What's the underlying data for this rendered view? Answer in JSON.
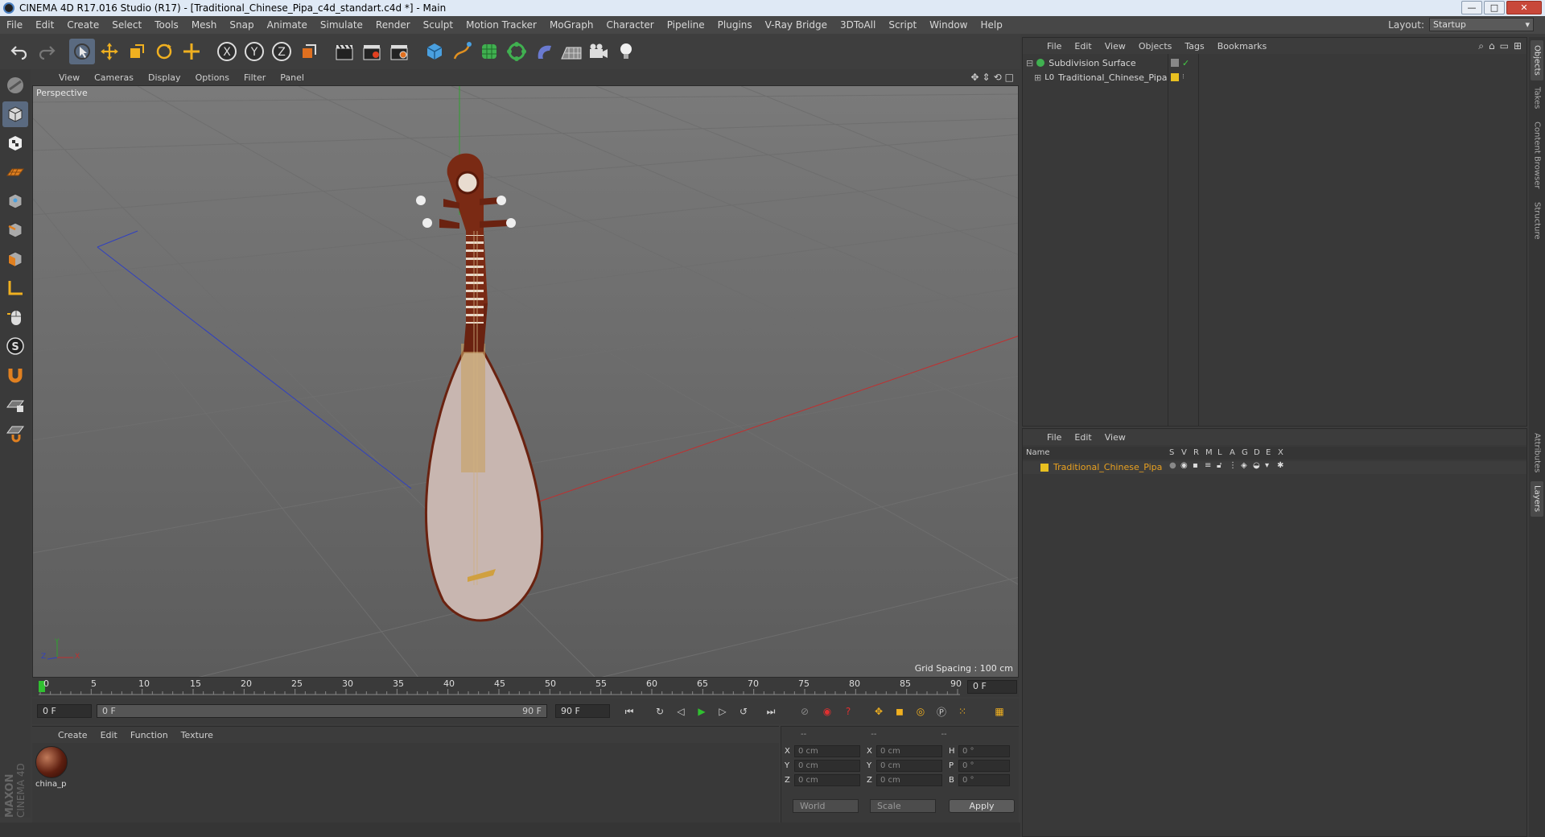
{
  "window": {
    "title": "CINEMA 4D R17.016 Studio (R17) - [Traditional_Chinese_Pipa_c4d_standart.c4d *] - Main",
    "buttons": {
      "minimize": "—",
      "maximize": "□",
      "close": "✕"
    }
  },
  "menubar": {
    "items": [
      "File",
      "Edit",
      "Create",
      "Select",
      "Tools",
      "Mesh",
      "Snap",
      "Animate",
      "Simulate",
      "Render",
      "Sculpt",
      "Motion Tracker",
      "MoGraph",
      "Character",
      "Pipeline",
      "Plugins",
      "V-Ray Bridge",
      "3DToAll",
      "Script",
      "Window",
      "Help"
    ],
    "layout_label": "Layout:",
    "layout_value": "Startup"
  },
  "viewport": {
    "menu": [
      "View",
      "Cameras",
      "Display",
      "Options",
      "Filter",
      "Panel"
    ],
    "camera_label": "Perspective",
    "grid_spacing": "Grid Spacing : 100 cm",
    "axis_labels": {
      "y": "Y",
      "x": "X",
      "z": "Z"
    }
  },
  "timeline": {
    "ticks": [
      "0",
      "5",
      "10",
      "15",
      "20",
      "25",
      "30",
      "35",
      "40",
      "45",
      "50",
      "55",
      "60",
      "65",
      "70",
      "75",
      "80",
      "85",
      "90"
    ],
    "current_frame": "0 F"
  },
  "playback": {
    "start_field": "0 F",
    "range_start": "0 F",
    "range_end": "90 F",
    "end_field": "90 F"
  },
  "material_manager": {
    "menu": [
      "Create",
      "Edit",
      "Function",
      "Texture"
    ],
    "materials": [
      {
        "name": "china_p"
      }
    ]
  },
  "coordinates": {
    "headers": [
      "--",
      "--",
      "--"
    ],
    "rows": [
      {
        "pos_axis": "X",
        "pos": "0 cm",
        "size_axis": "X",
        "size": "0 cm",
        "rot_axis": "H",
        "rot": "0 °"
      },
      {
        "pos_axis": "Y",
        "pos": "0 cm",
        "size_axis": "Y",
        "size": "0 cm",
        "rot_axis": "P",
        "rot": "0 °"
      },
      {
        "pos_axis": "Z",
        "pos": "0 cm",
        "size_axis": "Z",
        "size": "0 cm",
        "rot_axis": "B",
        "rot": "0 °"
      }
    ],
    "space": "World",
    "mode": "Scale",
    "apply": "Apply"
  },
  "object_manager": {
    "menu": [
      "File",
      "Edit",
      "View",
      "Objects",
      "Tags",
      "Bookmarks"
    ],
    "objects": [
      {
        "name": "Subdivision Surface",
        "level": 0
      },
      {
        "name": "Traditional_Chinese_Pipa",
        "level": 1
      }
    ]
  },
  "layer_manager": {
    "menu": [
      "File",
      "Edit",
      "View"
    ],
    "columns": [
      "Name",
      "S",
      "V",
      "R",
      "M",
      "L",
      "A",
      "G",
      "D",
      "E",
      "X"
    ],
    "layers": [
      {
        "name": "Traditional_Chinese_Pipa",
        "color": "#e8c020"
      }
    ]
  },
  "right_tabs": [
    "Objects",
    "Takes",
    "Content Browser",
    "Structure",
    "Attributes",
    "Layers"
  ],
  "branding": {
    "logo": "MAXON CINEMA 4D"
  },
  "colors": {
    "accent_blue": "#5a6a80",
    "layer_orange": "#e8a020",
    "axis_x": "#c03030",
    "axis_y": "#30a030",
    "axis_z": "#3040c0"
  }
}
